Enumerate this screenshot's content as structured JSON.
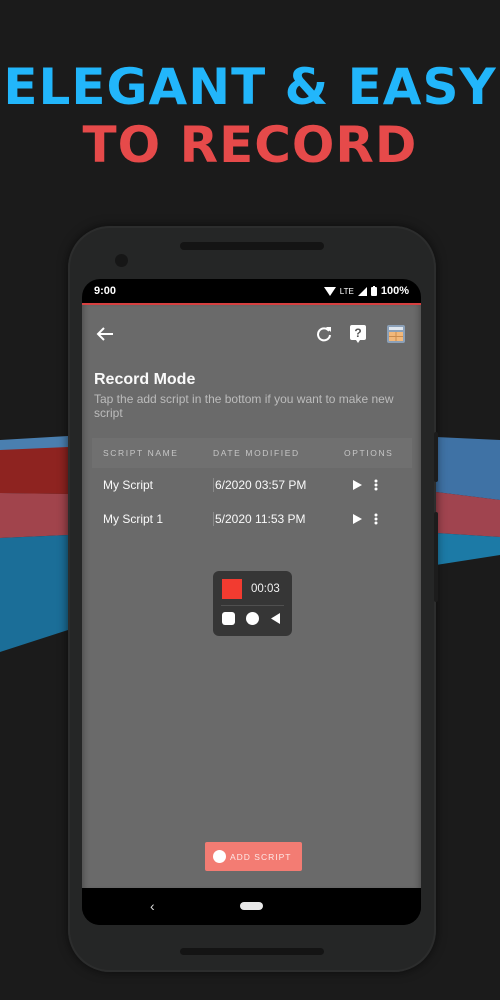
{
  "headline": {
    "line1": "ELEGANT & EASY",
    "line2": "TO RECORD",
    "line1_color": "#22b6fb",
    "line2_color": "#e64a4a"
  },
  "status_bar": {
    "time": "9:00",
    "network": "LTE",
    "battery": "100%",
    "icons": [
      "wifi-icon",
      "signal-icon",
      "battery-icon"
    ]
  },
  "toolbar": {
    "back_icon": "arrow-left-icon",
    "actions": [
      {
        "icon": "refresh-icon",
        "label": "Refresh"
      },
      {
        "icon": "help-icon",
        "label": "Help"
      },
      {
        "icon": "calculator-icon",
        "label": "Calculator"
      }
    ]
  },
  "main": {
    "title": "Record Mode",
    "subtitle": "Tap the add script in the bottom if you want to make new script"
  },
  "table": {
    "columns": [
      "SCRIPT NAME",
      "DATE MODIFIED",
      "OPTIONS"
    ],
    "rows": [
      {
        "name": "My Script",
        "date": "6/2020 03:57 PM"
      },
      {
        "name": "My Script 1",
        "date": "5/2020 11:53 PM"
      }
    ],
    "row_actions": [
      "play-icon",
      "more-vertical-icon"
    ]
  },
  "recorder": {
    "time": "00:03",
    "stop_color": "#f23b30",
    "controls": [
      "stop-icon",
      "record-icon",
      "back-icon"
    ]
  },
  "add_button": {
    "label": "ADD SCRIPT",
    "color": "#f37c73"
  },
  "colors": {
    "app_background": "#6a6a6a",
    "accent_line": "#d64040"
  }
}
